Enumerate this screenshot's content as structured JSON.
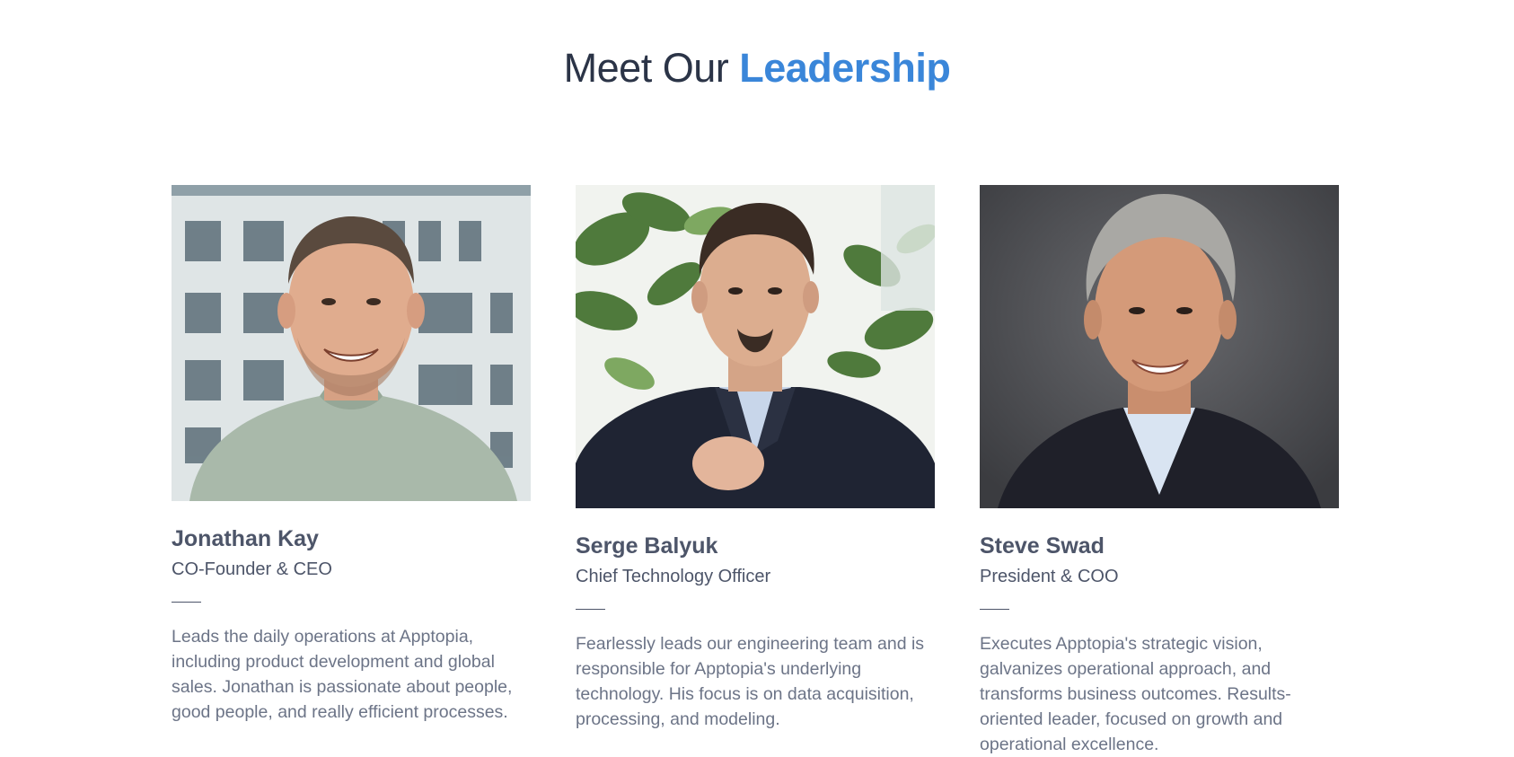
{
  "section": {
    "title_prefix": "Meet Our",
    "title_accent": "Leadership"
  },
  "leaders": [
    {
      "name": "Jonathan Kay",
      "role": "CO-Founder & CEO",
      "bio": "Leads the daily operations at Apptopia, including product development and global sales. Jonathan is passionate about people, good people, and really efficient processes."
    },
    {
      "name": "Serge Balyuk",
      "role": "Chief Technology Officer",
      "bio": "Fearlessly leads our engineering team and is responsible for Apptopia's underlying technology. His focus is on data acquisition, processing, and modeling."
    },
    {
      "name": "Steve Swad",
      "role": "President & COO",
      "bio": "Executes Apptopia's strategic vision, galvanizes operational approach, and transforms business outcomes. Results-oriented leader, focused on growth and operational excellence."
    }
  ],
  "colors": {
    "accent": "#3a86d9",
    "heading": "#2b3447",
    "text": "#4d5569",
    "body": "#6c7487"
  }
}
